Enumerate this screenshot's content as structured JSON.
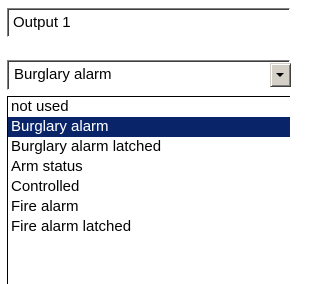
{
  "output_name": {
    "value": "Output 1"
  },
  "function_select": {
    "selected_value": "Burglary alarm",
    "button_icon": "chevron-down-icon"
  },
  "dropdown": {
    "options": [
      "not used",
      "Burglary alarm",
      "Burglary alarm latched",
      "Arm status",
      "Controlled",
      "Fire alarm",
      "Fire alarm latched"
    ],
    "highlighted_option": "Burglary alarm"
  },
  "colors": {
    "selection_background": "#0a246a",
    "selection_text": "#ffffff",
    "button_face": "#d4d0c8"
  }
}
